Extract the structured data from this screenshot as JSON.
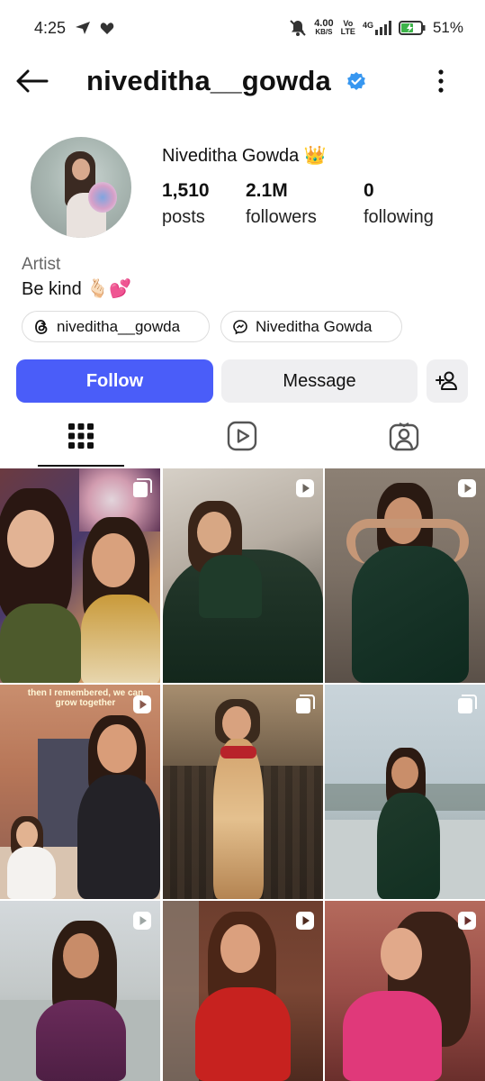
{
  "status_bar": {
    "time": "4:25",
    "net_speed": "4.00",
    "net_unit": "KB/S",
    "volte_top": "Vo",
    "volte_bottom": "LTE",
    "signal": "4G",
    "battery": "51%"
  },
  "header": {
    "username": "niveditha__gowda",
    "back_icon": "arrow-left-icon",
    "verified_icon": "verified-badge-icon",
    "more_icon": "vertical-dots-icon"
  },
  "profile": {
    "display_name": "Niveditha Gowda",
    "name_emoji": "👑",
    "stats": {
      "posts_count": "1,510",
      "posts_label": "posts",
      "followers_count": "2.1M",
      "followers_label": "followers",
      "following_count": "0",
      "following_label": "following"
    },
    "category": "Artist",
    "bio": "Be kind 🫰🏻💕",
    "links": [
      {
        "label": "niveditha__gowda",
        "icon": "threads-icon"
      },
      {
        "label": "Niveditha Gowda",
        "icon": "facebook-link-icon"
      }
    ]
  },
  "actions": {
    "follow_label": "Follow",
    "message_label": "Message",
    "add_icon": "add-person-icon"
  },
  "tabs": [
    {
      "name": "posts-grid",
      "icon": "grid-icon",
      "active": true
    },
    {
      "name": "reels",
      "icon": "reels-icon",
      "active": false
    },
    {
      "name": "tagged",
      "icon": "tagged-icon",
      "active": false
    }
  ],
  "grid": {
    "posts": [
      {
        "badge": "carousel-icon"
      },
      {
        "badge": "reel-icon"
      },
      {
        "badge": "reel-icon"
      },
      {
        "badge": "reel-icon"
      },
      {
        "badge": "carousel-icon"
      },
      {
        "badge": "carousel-icon"
      },
      {
        "badge": "reel-icon"
      },
      {
        "badge": "reel-icon"
      },
      {
        "badge": "reel-icon"
      }
    ],
    "overlay_text": "then I remembered, we can grow together"
  },
  "colors": {
    "accent": "#4a5df9",
    "verified": "#3897f0",
    "secondary_button": "#efeff1"
  }
}
